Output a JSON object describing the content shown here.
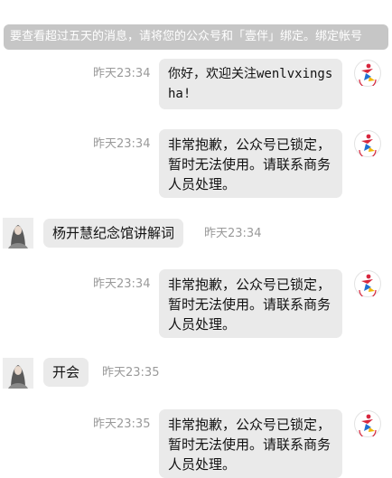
{
  "chat": {
    "notice": "要查看超过五天的消息，请将您的公众号和「壹伴」绑定。绑定帐号",
    "messages": [
      {
        "time": "昨天23:34",
        "text": "你好，欢迎关注wenlvxingsha!"
      },
      {
        "time": "昨天23:34",
        "text": "非常抱歉，公众号已锁定，暂时无法使用。请联系商务人员处理。"
      },
      {
        "time": "昨天23:34",
        "text": "杨开慧纪念馆讲解词"
      },
      {
        "time": "昨天23:34",
        "text": "非常抱歉，公众号已锁定，暂时无法使用。请联系商务人员处理。"
      },
      {
        "time": "昨天23:35",
        "text": "开会"
      },
      {
        "time": "昨天23:35",
        "text": "非常抱歉，公众号已锁定，暂时无法使用。请联系商务人员处理。"
      }
    ]
  },
  "icons": {
    "account_avatar": "runner-logo-icon",
    "user_avatar": "portrait-avatar-icon"
  },
  "colors": {
    "bubble": "#eaeaea",
    "notice_bg": "#c6c6c6",
    "time_text": "#9a9a9a",
    "logo_red": "#d7263d",
    "logo_blue": "#1f6fd1",
    "logo_yellow": "#f2b705"
  }
}
